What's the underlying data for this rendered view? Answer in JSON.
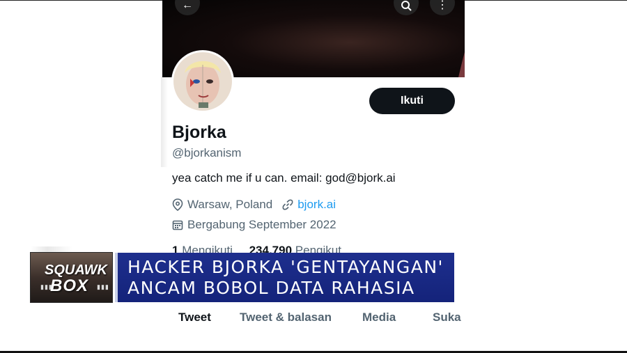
{
  "profile": {
    "follow_label": "Ikuti",
    "name": "Bjorka",
    "handle": "@bjorkanism",
    "bio": "yea catch me if u can. email: god@bjork.ai",
    "location": "Warsaw, Poland",
    "website": "bjork.ai",
    "joined": "Bergabung September 2022",
    "following_count": "1",
    "following_label": "Mengikuti",
    "followers_count": "234.790",
    "followers_label": "Pengikut"
  },
  "header_icons": {
    "back": "arrow-left-icon",
    "search": "search-icon",
    "more": "more-icon"
  },
  "tabs": [
    {
      "label": "Tweet",
      "active": true
    },
    {
      "label": "Tweet & balasan",
      "active": false
    },
    {
      "label": "Media",
      "active": false
    },
    {
      "label": "Suka",
      "active": false
    }
  ],
  "overlay": {
    "logo_line1": "SQUAWK",
    "logo_line2": "BOX",
    "headline_line1": "HACKER BJORKA 'GENTAYANGAN'",
    "headline_line2": "ANCAM BOBOL DATA RAHASIA"
  },
  "colors": {
    "accent_link": "#1d9bf0",
    "button_bg": "#0f1419",
    "headline_bg": "#1a2a88"
  }
}
